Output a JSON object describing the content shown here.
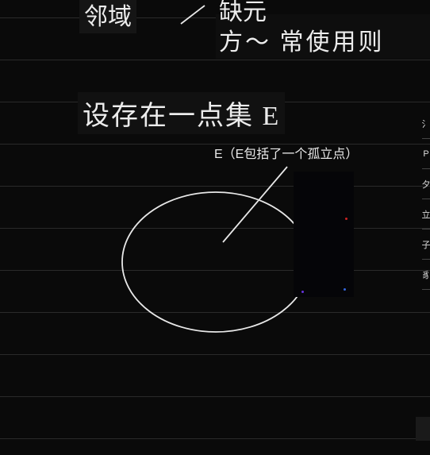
{
  "handwriting": {
    "top_left": "邻域",
    "top_right_line1": "缺元",
    "top_right_line2": "方～ 常使用则",
    "middle": "设存在一点集 E"
  },
  "label": {
    "e_isolated": "E（E包括了一个孤立点）"
  },
  "side_items": [
    "氵",
    "P",
    "夕",
    "立",
    "子",
    "豸"
  ],
  "colors": {
    "bg": "#0a0a0a",
    "ink": "#ececec",
    "rule": "#2a2a2a"
  }
}
